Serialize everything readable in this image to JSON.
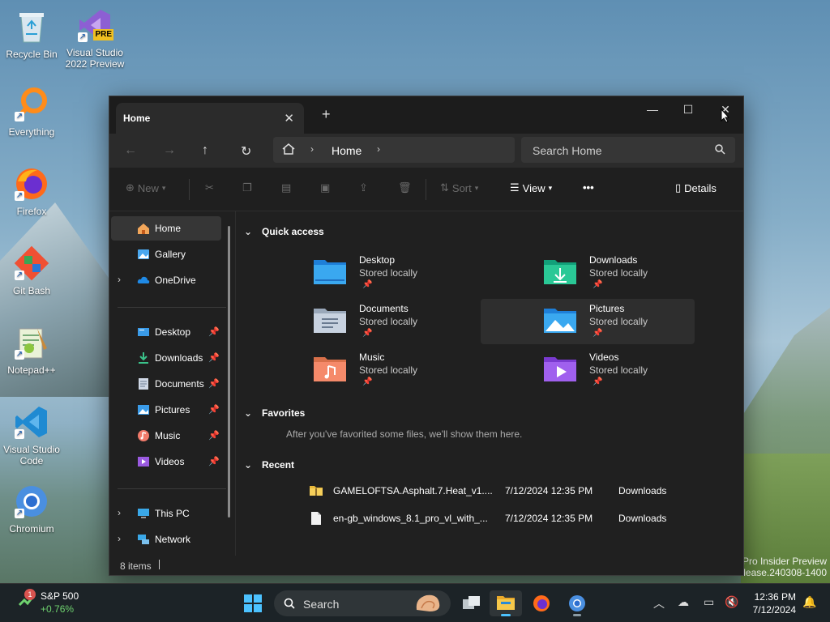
{
  "desktop": {
    "icons": [
      {
        "label": "Recycle Bin",
        "icon": "recycle-bin-icon"
      },
      {
        "label": "Visual Studio 2022 Preview",
        "icon": "visual-studio-icon",
        "badge": "PRE"
      },
      {
        "label": "Everything",
        "icon": "everything-search-icon"
      },
      {
        "label": "Firefox",
        "icon": "firefox-icon"
      },
      {
        "label": "Git Bash",
        "icon": "git-bash-icon"
      },
      {
        "label": "Notepad++",
        "icon": "notepad-plus-plus-icon"
      },
      {
        "label": "Visual Studio Code",
        "icon": "vscode-icon"
      },
      {
        "label": "Chromium",
        "icon": "chromium-icon"
      }
    ],
    "watermark": {
      "line1": "Pro Insider Preview",
      "line2": "elease.240308-1400"
    }
  },
  "window": {
    "tab_title": "Home",
    "tab_close": "✕",
    "new_tab": "+",
    "controls": {
      "minimize": "—",
      "maximize": "☐",
      "close": "✕"
    },
    "nav": {
      "back": "←",
      "forward": "→",
      "up": "↑",
      "refresh": "↻"
    },
    "address": {
      "crumb": "Home",
      "chevron": "›"
    },
    "search_placeholder": "Search Home",
    "toolbar": {
      "new": "New",
      "sort": "Sort",
      "view": "View",
      "more": "•••",
      "details": "Details"
    },
    "sidebar": {
      "top": [
        {
          "label": "Home",
          "icon": "home-icon"
        },
        {
          "label": "Gallery",
          "icon": "gallery-icon"
        },
        {
          "label": "OneDrive",
          "icon": "onedrive-icon"
        }
      ],
      "pinned": [
        {
          "label": "Desktop",
          "icon": "desktop-folder-icon"
        },
        {
          "label": "Downloads",
          "icon": "downloads-icon"
        },
        {
          "label": "Documents",
          "icon": "documents-icon"
        },
        {
          "label": "Pictures",
          "icon": "pictures-icon"
        },
        {
          "label": "Music",
          "icon": "music-icon"
        },
        {
          "label": "Videos",
          "icon": "videos-icon"
        }
      ],
      "bottom": [
        {
          "label": "This PC",
          "icon": "this-pc-icon"
        },
        {
          "label": "Network",
          "icon": "network-icon"
        }
      ]
    },
    "quick_access": {
      "header": "Quick access",
      "items": [
        {
          "name": "Desktop",
          "sub": "Stored locally",
          "icon": "desktop-folder-icon"
        },
        {
          "name": "Downloads",
          "sub": "Stored locally",
          "icon": "downloads-folder-icon"
        },
        {
          "name": "Documents",
          "sub": "Stored locally",
          "icon": "documents-folder-icon"
        },
        {
          "name": "Pictures",
          "sub": "Stored locally",
          "icon": "pictures-folder-icon"
        },
        {
          "name": "Music",
          "sub": "Stored locally",
          "icon": "music-folder-icon"
        },
        {
          "name": "Videos",
          "sub": "Stored locally",
          "icon": "videos-folder-icon"
        }
      ]
    },
    "favorites": {
      "header": "Favorites",
      "empty_text": "After you've favorited some files, we'll show them here."
    },
    "recent": {
      "header": "Recent",
      "rows": [
        {
          "name": "GAMELOFTSA.Asphalt.7.Heat_v1....",
          "date": "7/12/2024 12:35 PM",
          "location": "Downloads",
          "icon": "zip-folder-icon"
        },
        {
          "name": "en-gb_windows_8.1_pro_vl_with_...",
          "date": "7/12/2024 12:35 PM",
          "location": "Downloads",
          "icon": "file-icon"
        }
      ]
    },
    "status": "8 items"
  },
  "taskbar": {
    "stock_badge": "1",
    "stock_name": "S&P 500",
    "stock_change": "+0.76%",
    "search": "Search",
    "time": "12:36 PM",
    "date": "7/12/2024"
  },
  "colors": {
    "accent": "#4cc2ff",
    "folder_blue": "#2f8de4",
    "folder_yellow": "#f2c14e"
  }
}
